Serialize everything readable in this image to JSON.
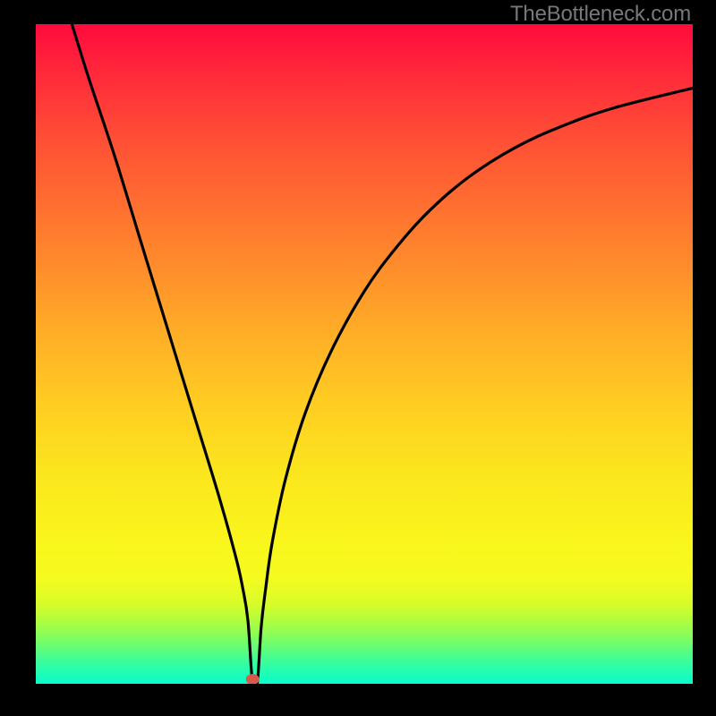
{
  "watermark": {
    "text": "TheBottleneck.com"
  },
  "chart_data": {
    "type": "line",
    "title": "",
    "xlabel": "",
    "ylabel": "",
    "xlim": [
      0,
      100
    ],
    "ylim": [
      0,
      100
    ],
    "grid": false,
    "legend": false,
    "marker": {
      "x": 33,
      "y": 0,
      "color": "#d85a4a"
    },
    "series": [
      {
        "name": "curve",
        "color": "#000000",
        "x": [
          5.5,
          8,
          12,
          16,
          20,
          24,
          28,
          30.5,
          31.5,
          32.3,
          33,
          33.7,
          34.3,
          35,
          36,
          38,
          41,
          45,
          50,
          55,
          60,
          66,
          73,
          80,
          88,
          100
        ],
        "values": [
          100,
          92,
          80,
          67,
          54,
          41,
          28,
          19,
          14.5,
          9.5,
          0,
          0,
          8.5,
          14.5,
          21.5,
          31,
          41,
          50.5,
          59.5,
          66.3,
          71.8,
          76.9,
          81.3,
          84.5,
          87.3,
          90.3
        ]
      }
    ]
  }
}
